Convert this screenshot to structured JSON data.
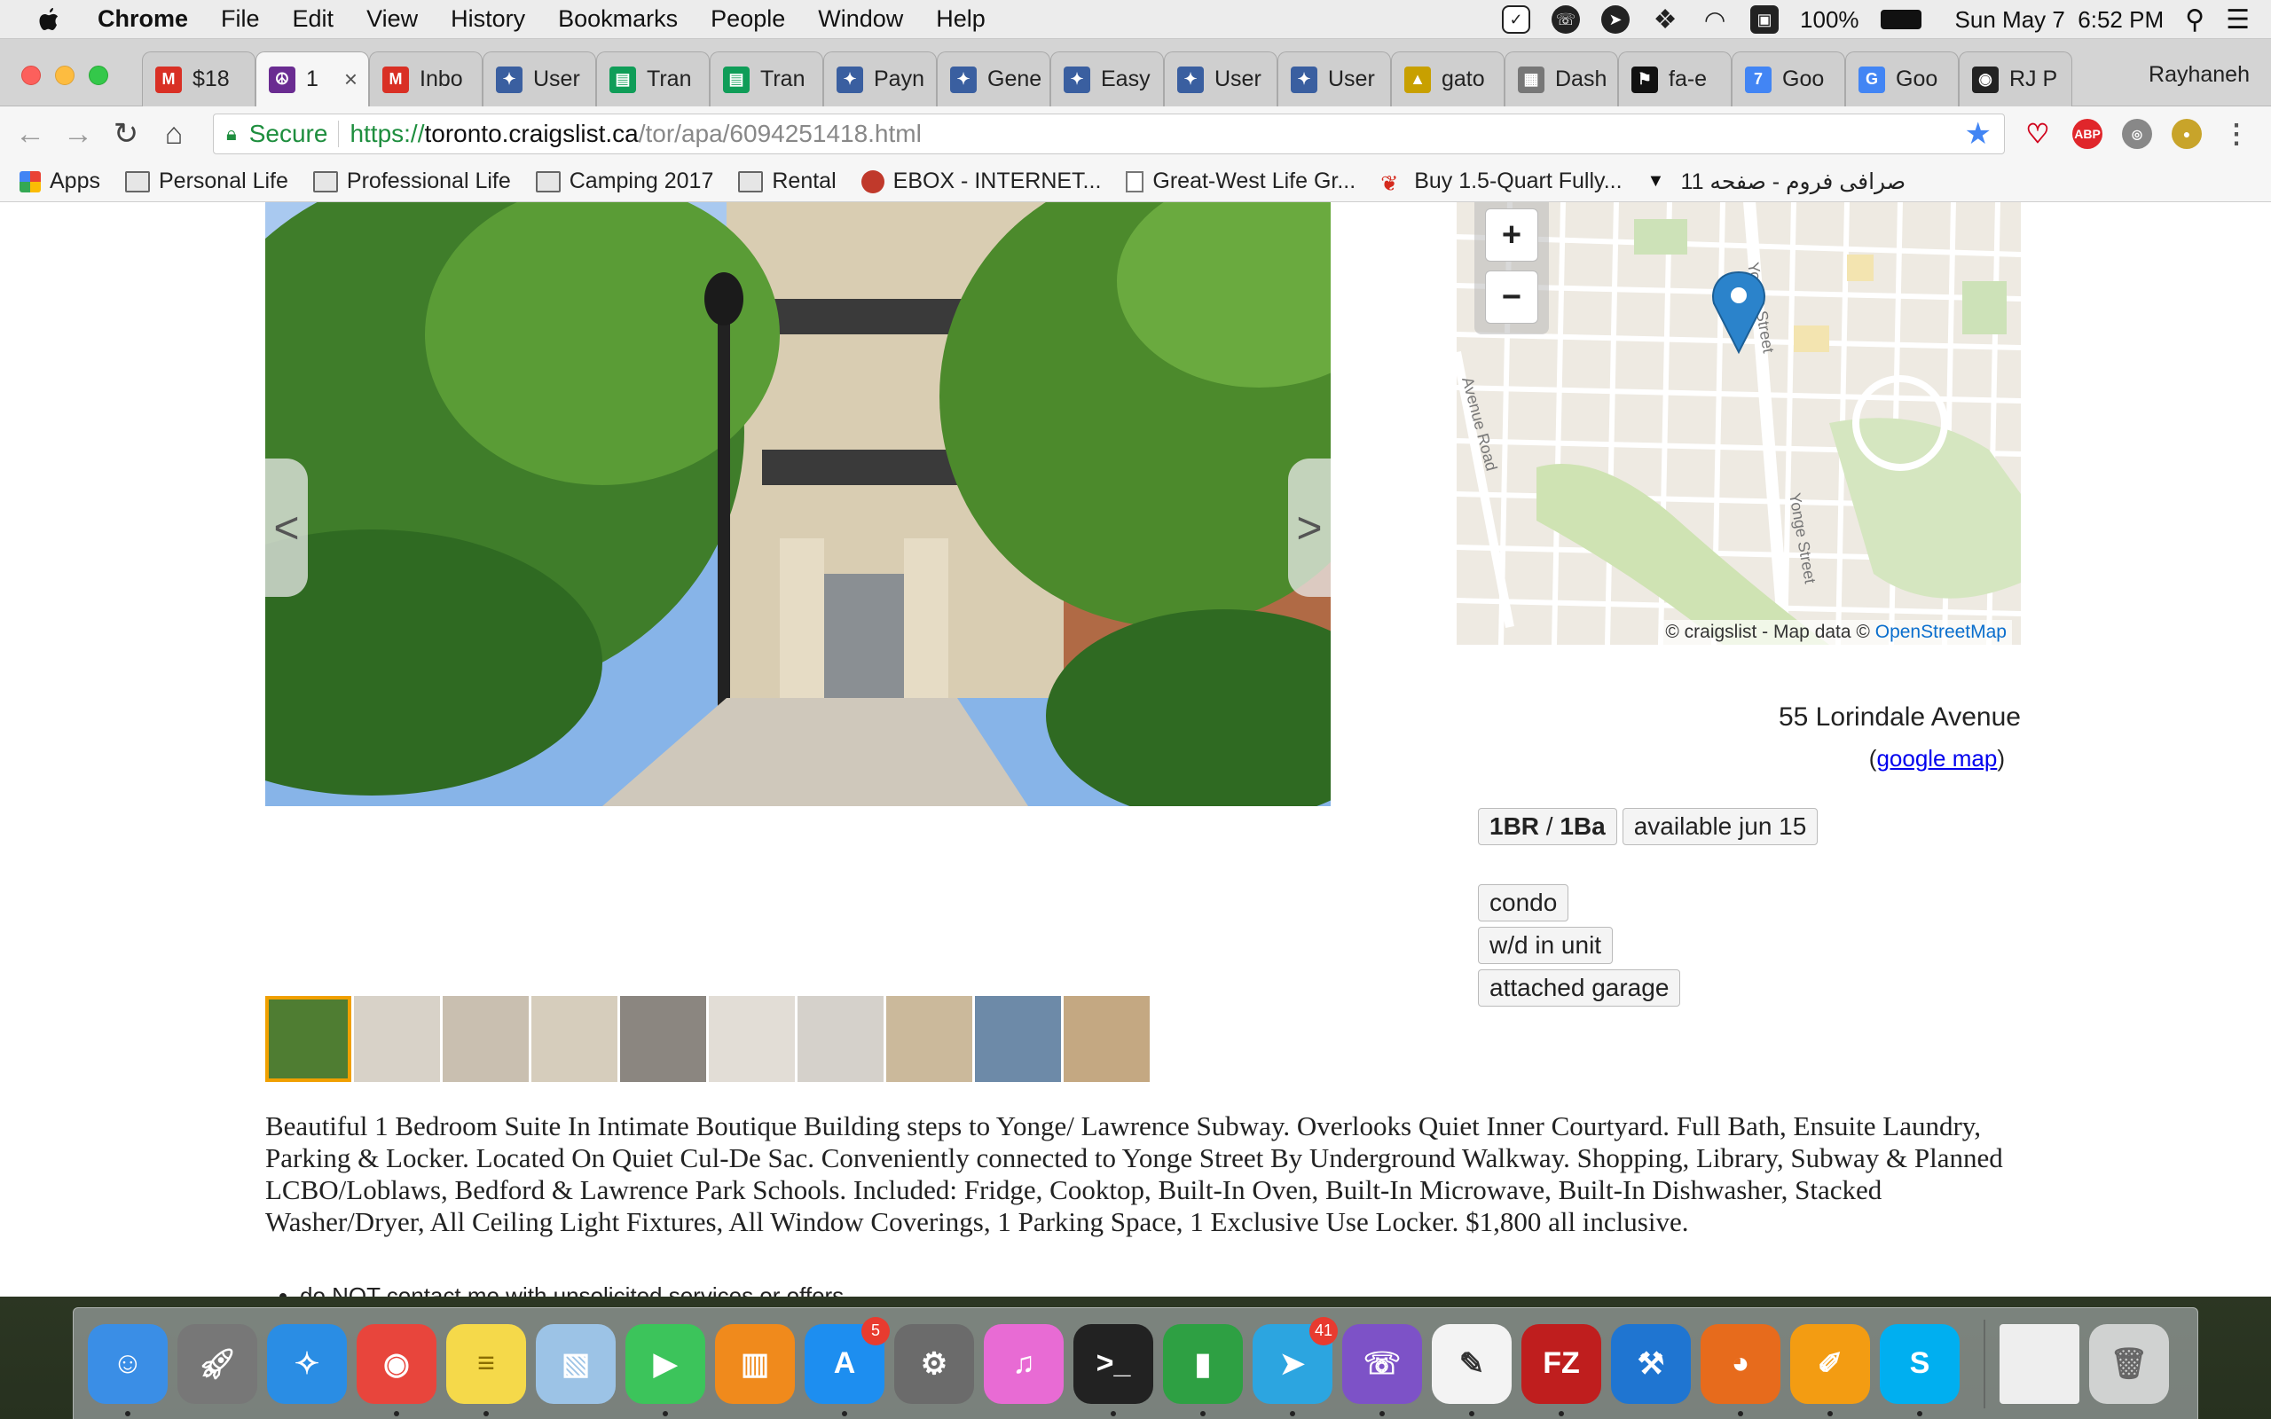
{
  "menubar": {
    "app": "Chrome",
    "items": [
      "File",
      "Edit",
      "View",
      "History",
      "Bookmarks",
      "People",
      "Window",
      "Help"
    ],
    "battery": "100%",
    "datetime": "Sun May 7  6:52 PM"
  },
  "tabs": [
    {
      "label": "$18",
      "icon": "gmail-icon",
      "color": "#d93025"
    },
    {
      "label": "1",
      "icon": "peace-icon",
      "color": "#6a2c91",
      "active": true
    },
    {
      "label": "Inbo",
      "icon": "gmail-icon",
      "color": "#d93025"
    },
    {
      "label": "User",
      "icon": "wizard-icon",
      "color": "#3a5fa0"
    },
    {
      "label": "Tran",
      "icon": "sheets-icon",
      "color": "#0f9d58"
    },
    {
      "label": "Tran",
      "icon": "sheets-icon",
      "color": "#0f9d58"
    },
    {
      "label": "Payn",
      "icon": "wizard-icon",
      "color": "#3a5fa0"
    },
    {
      "label": "Gene",
      "icon": "wizard-icon",
      "color": "#3a5fa0"
    },
    {
      "label": "Easy",
      "icon": "wizard-icon",
      "color": "#3a5fa0"
    },
    {
      "label": "User",
      "icon": "wizard-icon",
      "color": "#3a5fa0"
    },
    {
      "label": "User",
      "icon": "wizard-icon",
      "color": "#3a5fa0"
    },
    {
      "label": "gato",
      "icon": "pma-icon",
      "color": "#c8a000"
    },
    {
      "label": "Dash",
      "icon": "dashboard-icon",
      "color": "#777"
    },
    {
      "label": "fa-e",
      "icon": "flag-icon",
      "color": "#111"
    },
    {
      "label": "Goo",
      "icon": "calendar-icon",
      "color": "#4285f4"
    },
    {
      "label": "Goo",
      "icon": "translate-icon",
      "color": "#4285f4"
    },
    {
      "label": "RJ P",
      "icon": "radio-icon",
      "color": "#222"
    }
  ],
  "profile": "Rayhaneh",
  "address": {
    "secure": "Secure",
    "proto": "https://",
    "host": "toronto.craigslist.ca",
    "path": "/tor/apa/6094251418.html"
  },
  "bookmarks": [
    {
      "label": "Apps",
      "icon": "apps-icon"
    },
    {
      "label": "Personal Life",
      "icon": "folder-icon"
    },
    {
      "label": "Professional Life",
      "icon": "folder-icon"
    },
    {
      "label": "Camping 2017",
      "icon": "folder-icon"
    },
    {
      "label": "Rental",
      "icon": "folder-icon"
    },
    {
      "label": "EBOX - INTERNET...",
      "icon": "ebox-icon"
    },
    {
      "label": "Great-West Life Gr...",
      "icon": "page-icon"
    },
    {
      "label": "Buy 1.5-Quart Fully...",
      "icon": "maple-leaf-icon"
    },
    {
      "label": "صرافی فروم - صفحه 11",
      "icon": "cap-icon"
    }
  ],
  "listing": {
    "address": "55 Lorindale Avenue",
    "google_map": "google map",
    "map_attribution": "© craigslist - Map data ©",
    "map_attribution_link": "OpenStreetMap",
    "map_labels": {
      "yonge1": "Yonge Street",
      "yonge2": "Yonge Street",
      "avenue": "Avenue Road"
    },
    "br": "1BR",
    "ba": "1Ba",
    "available": "available jun 15",
    "attrs": [
      "condo",
      "w/d in unit",
      "attached garage"
    ],
    "description": "Beautiful 1 Bedroom Suite In Intimate Boutique Building steps to Yonge/ Lawrence Subway. Overlooks Quiet Inner Courtyard. Full Bath, Ensuite Laundry, Parking & Locker. Located On Quiet Cul-De Sac. Conveniently connected to Yonge Street By Underground Walkway. Shopping, Library, Subway & Planned LCBO/Loblaws, Bedford & Lawrence Park Schools. Included: Fridge, Cooktop, Built-In Oven, Built-In Microwave, Built-In Dishwasher, Stacked Washer/Dryer, All Ceiling Light Fixtures, All Window Coverings, 1 Parking Space, 1 Exclusive Use Locker. $1,800 all inclusive.",
    "notice": "do NOT contact me with unsolicited services or offers",
    "thumb_count": 10
  },
  "dock": [
    {
      "name": "finder-icon",
      "color": "#3a8ee6"
    },
    {
      "name": "launchpad-icon",
      "color": "#777"
    },
    {
      "name": "safari-icon",
      "color": "#2a8de4"
    },
    {
      "name": "chrome-icon",
      "color": "#e8453c"
    },
    {
      "name": "notes-icon",
      "color": "#f5d94a"
    },
    {
      "name": "preview-icon",
      "color": "#9cc3e6"
    },
    {
      "name": "facetime-icon",
      "color": "#3cc45b"
    },
    {
      "name": "ibooks-icon",
      "color": "#f08a1c"
    },
    {
      "name": "app-store-icon",
      "color": "#1d8ef0",
      "badge": "5"
    },
    {
      "name": "system-preferences-icon",
      "color": "#6b6b6b"
    },
    {
      "name": "itunes-icon",
      "color": "#e86bd4"
    },
    {
      "name": "terminal-icon",
      "color": "#222"
    },
    {
      "name": "numbers-icon",
      "color": "#2ea043"
    },
    {
      "name": "telegram-icon",
      "color": "#2ca5e0",
      "badge": "41"
    },
    {
      "name": "viber-icon",
      "color": "#7d52c7"
    },
    {
      "name": "textedit-icon",
      "color": "#f3f3f3"
    },
    {
      "name": "filezilla-icon",
      "color": "#bf1e1e"
    },
    {
      "name": "xcode-icon",
      "color": "#1f75d1"
    },
    {
      "name": "firefox-icon",
      "color": "#e76b1c"
    },
    {
      "name": "pages-icon",
      "color": "#f39c12"
    },
    {
      "name": "skype-icon",
      "color": "#00aff0"
    }
  ]
}
